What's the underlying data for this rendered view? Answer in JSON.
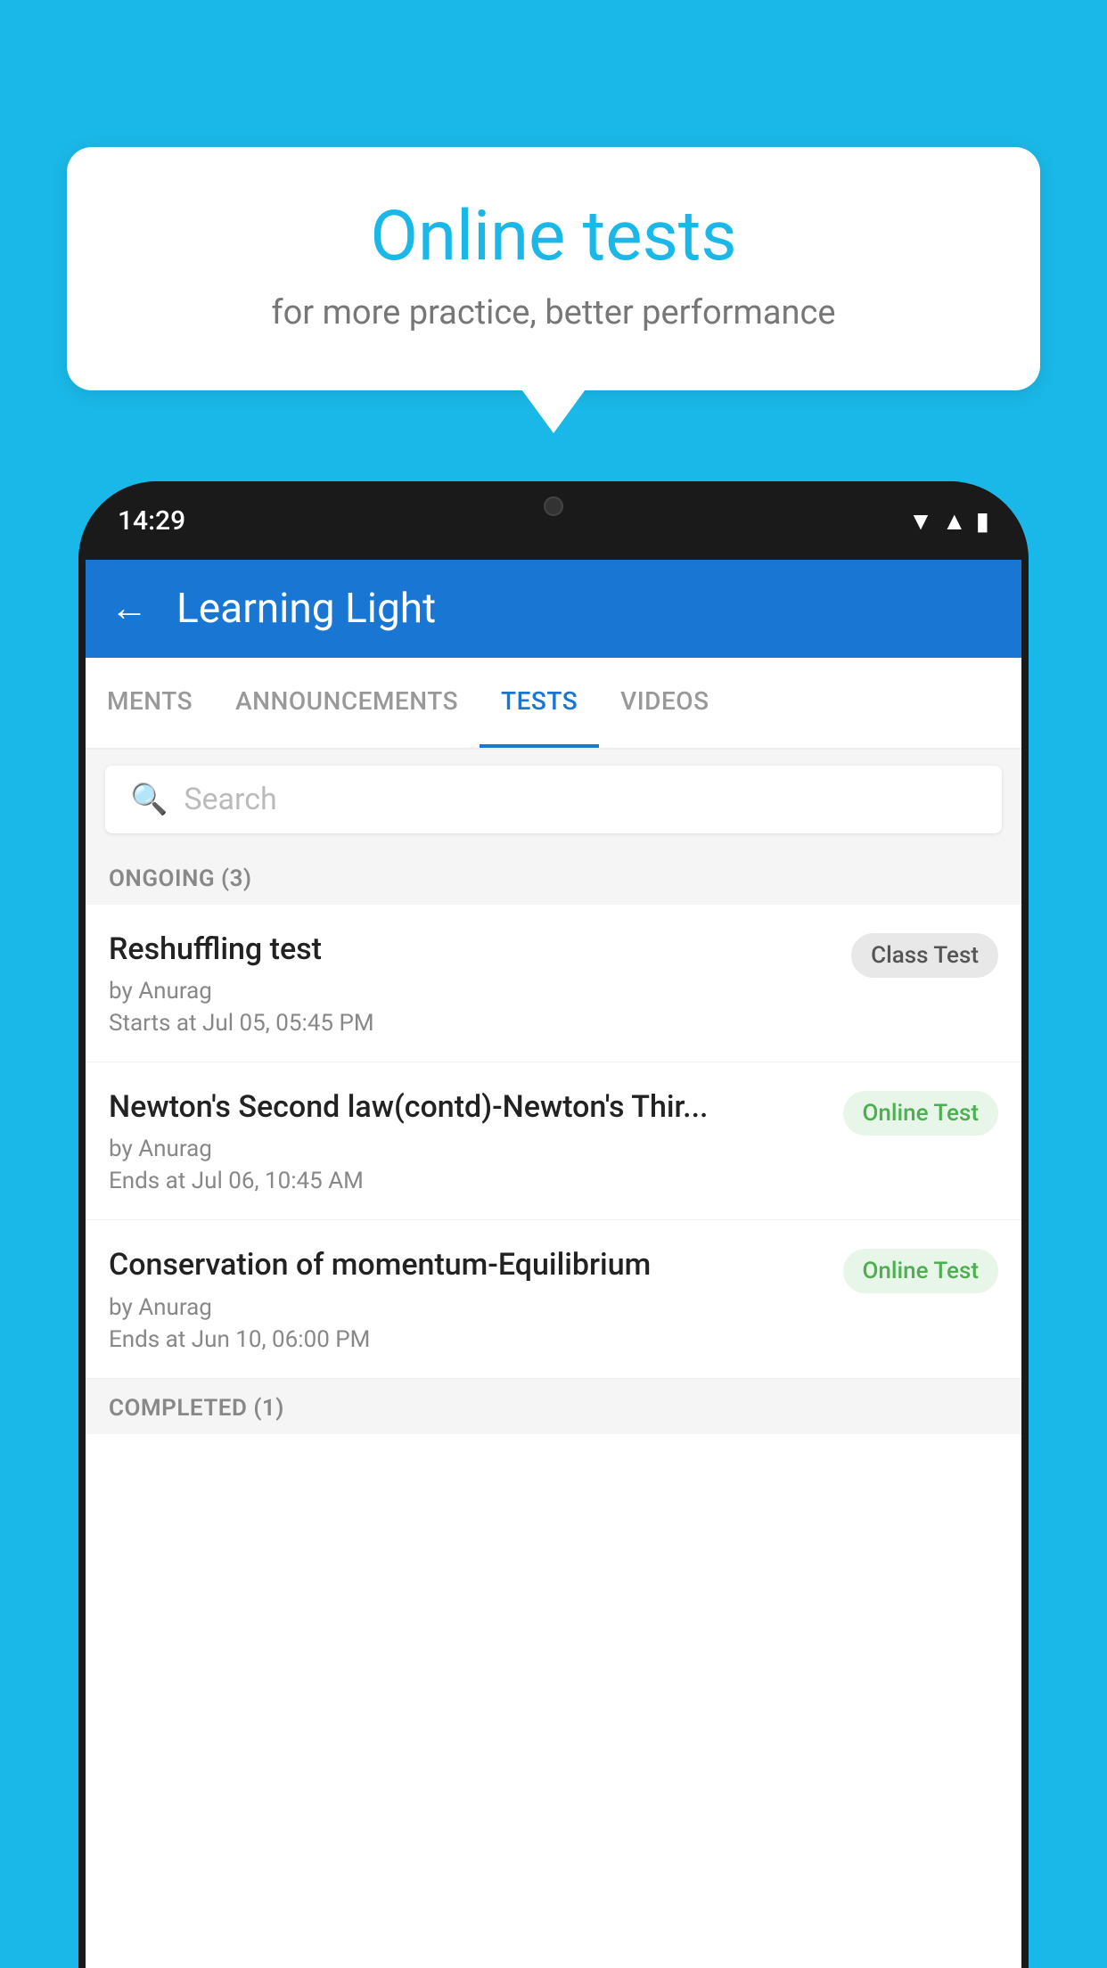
{
  "background_color": "#1ab8e8",
  "speech_bubble": {
    "title": "Online tests",
    "subtitle": "for more practice, better performance"
  },
  "phone": {
    "status_bar": {
      "time": "14:29"
    },
    "app_header": {
      "title": "Learning Light",
      "back_label": "←"
    },
    "tabs": [
      {
        "label": "MENTS",
        "active": false
      },
      {
        "label": "ANNOUNCEMENTS",
        "active": false
      },
      {
        "label": "TESTS",
        "active": true
      },
      {
        "label": "VIDEOS",
        "active": false
      }
    ],
    "search": {
      "placeholder": "Search"
    },
    "ongoing_section": {
      "label": "ONGOING (3)"
    },
    "test_items": [
      {
        "name": "Reshuffling test",
        "author": "by Anurag",
        "time_label": "Starts at",
        "time_value": "Jul 05, 05:45 PM",
        "badge": "Class Test",
        "badge_type": "class"
      },
      {
        "name": "Newton's Second law(contd)-Newton's Thir...",
        "author": "by Anurag",
        "time_label": "Ends at",
        "time_value": "Jul 06, 10:45 AM",
        "badge": "Online Test",
        "badge_type": "online"
      },
      {
        "name": "Conservation of momentum-Equilibrium",
        "author": "by Anurag",
        "time_label": "Ends at",
        "time_value": "Jun 10, 06:00 PM",
        "badge": "Online Test",
        "badge_type": "online"
      }
    ],
    "completed_section": {
      "label": "COMPLETED (1)"
    }
  }
}
